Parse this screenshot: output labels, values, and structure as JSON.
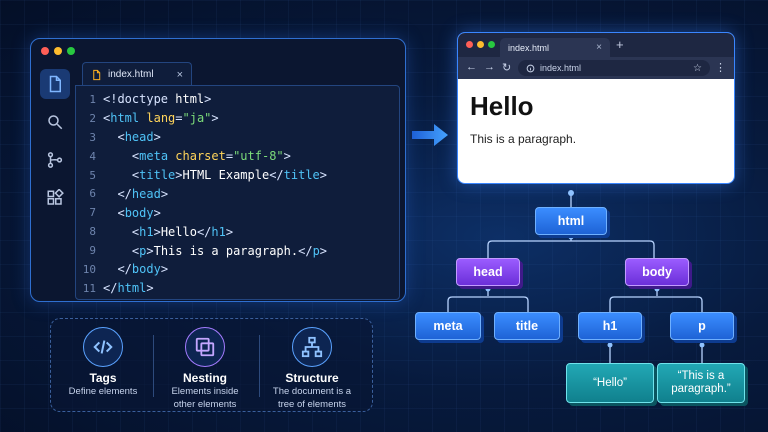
{
  "editor": {
    "tab_label": "index.html",
    "close_glyph": "×",
    "sidebar_icons": [
      "files-icon",
      "search-icon",
      "source-control-icon",
      "extensions-icon"
    ],
    "lines": [
      {
        "num": "1",
        "indent": "",
        "tokens": [
          [
            "t-punc",
            "<!doctype"
          ],
          [
            "t-txt",
            " html"
          ],
          [
            "t-punc",
            ">"
          ]
        ]
      },
      {
        "num": "2",
        "indent": "",
        "tokens": [
          [
            "t-punc",
            "<"
          ],
          [
            "t-tag",
            "html"
          ],
          [
            "t-attr",
            " lang"
          ],
          [
            "t-punc",
            "="
          ],
          [
            "t-val",
            "\"ja\""
          ],
          [
            "t-punc",
            ">"
          ]
        ]
      },
      {
        "num": "3",
        "indent": "  ",
        "tokens": [
          [
            "t-punc",
            "<"
          ],
          [
            "t-tag",
            "head"
          ],
          [
            "t-punc",
            ">"
          ]
        ]
      },
      {
        "num": "4",
        "indent": "    ",
        "tokens": [
          [
            "t-punc",
            "<"
          ],
          [
            "t-tag",
            "meta"
          ],
          [
            "t-attr",
            " charset"
          ],
          [
            "t-punc",
            "="
          ],
          [
            "t-val",
            "\"utf-8\""
          ],
          [
            "t-punc",
            ">"
          ]
        ]
      },
      {
        "num": "5",
        "indent": "    ",
        "tokens": [
          [
            "t-punc",
            "<"
          ],
          [
            "t-tag",
            "title"
          ],
          [
            "t-punc",
            ">"
          ],
          [
            "t-txt",
            "HTML Example"
          ],
          [
            "t-punc",
            "</"
          ],
          [
            "t-tag",
            "title"
          ],
          [
            "t-punc",
            ">"
          ]
        ]
      },
      {
        "num": "6",
        "indent": "  ",
        "tokens": [
          [
            "t-punc",
            "</"
          ],
          [
            "t-tag",
            "head"
          ],
          [
            "t-punc",
            ">"
          ]
        ]
      },
      {
        "num": "7",
        "indent": "  ",
        "tokens": [
          [
            "t-punc",
            "<"
          ],
          [
            "t-tag",
            "body"
          ],
          [
            "t-punc",
            ">"
          ]
        ]
      },
      {
        "num": "8",
        "indent": "    ",
        "tokens": [
          [
            "t-punc",
            "<"
          ],
          [
            "t-tag",
            "h1"
          ],
          [
            "t-punc",
            ">"
          ],
          [
            "t-txt",
            "Hello"
          ],
          [
            "t-punc",
            "</"
          ],
          [
            "t-tag",
            "h1"
          ],
          [
            "t-punc",
            ">"
          ]
        ]
      },
      {
        "num": "9",
        "indent": "    ",
        "tokens": [
          [
            "t-punc",
            "<"
          ],
          [
            "t-tag",
            "p"
          ],
          [
            "t-punc",
            ">"
          ],
          [
            "t-txt",
            "This is a paragraph."
          ],
          [
            "t-punc",
            "</"
          ],
          [
            "t-tag",
            "p"
          ],
          [
            "t-punc",
            ">"
          ]
        ]
      },
      {
        "num": "10",
        "indent": "  ",
        "tokens": [
          [
            "t-punc",
            "</"
          ],
          [
            "t-tag",
            "body"
          ],
          [
            "t-punc",
            ">"
          ]
        ]
      },
      {
        "num": "11",
        "indent": "",
        "tokens": [
          [
            "t-punc",
            "</"
          ],
          [
            "t-tag",
            "html"
          ],
          [
            "t-punc",
            ">"
          ]
        ]
      }
    ]
  },
  "concepts": [
    {
      "icon": "code-icon",
      "title": "Tags",
      "desc_1": "Define elements",
      "desc_2": ""
    },
    {
      "icon": "layers-icon",
      "title": "Nesting",
      "desc_1": "Elements inside",
      "desc_2": "other elements"
    },
    {
      "icon": "hierarchy-icon",
      "title": "Structure",
      "desc_1": "The document is a",
      "desc_2": "tree of elements"
    }
  ],
  "browser": {
    "tab_label": "index.html",
    "close_glyph": "×",
    "new_tab_glyph": "+",
    "url": "index.html",
    "page_heading": "Hello",
    "page_paragraph": "This is a paragraph."
  },
  "tree": {
    "root": "html",
    "head": "head",
    "body": "body",
    "meta": "meta",
    "title": "title",
    "h1": "h1",
    "p": "p",
    "h1_text": "“Hello”",
    "p_text_1": "“This is a",
    "p_text_2": "paragraph.”"
  },
  "colors": {
    "accent_blue": "#3a86ff",
    "node_purple": "#7b3ff0",
    "node_teal": "#1a9aa6",
    "tag_color": "#4fc3f7",
    "attr_color": "#ffd45a",
    "value_color": "#7cdc7a"
  }
}
